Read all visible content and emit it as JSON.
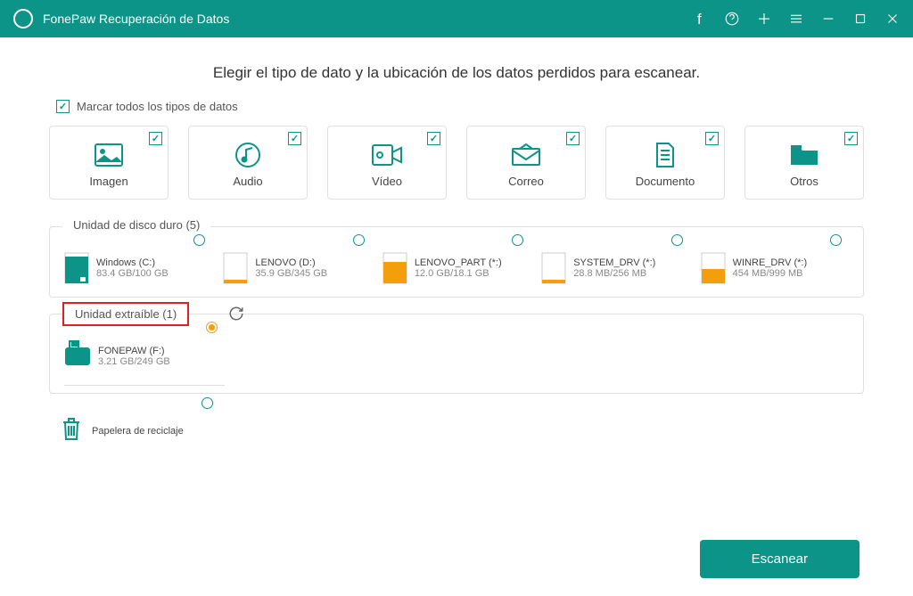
{
  "app": {
    "title": "FonePaw Recuperación de Datos"
  },
  "heading": "Elegir el tipo de dato y la ubicación de los datos perdidos para escanear.",
  "masterCheck": "Marcar todos los tipos de datos",
  "types": [
    {
      "label": "Imagen"
    },
    {
      "label": "Audio"
    },
    {
      "label": "Vídeo"
    },
    {
      "label": "Correo"
    },
    {
      "label": "Documento"
    },
    {
      "label": "Otros"
    }
  ],
  "hdd": {
    "title": "Unidad de disco duro (5)",
    "drives": [
      {
        "name": "Windows (C:)",
        "size": "83.4 GB/100 GB",
        "fill": 0.83,
        "color": "#0d9488"
      },
      {
        "name": "LENOVO (D:)",
        "size": "35.9 GB/345 GB",
        "fill": 0.1,
        "color": "#f59e0b"
      },
      {
        "name": "LENOVO_PART (*:)",
        "size": "12.0 GB/18.1 GB",
        "fill": 0.66,
        "color": "#f59e0b"
      },
      {
        "name": "SYSTEM_DRV (*:)",
        "size": "28.8 MB/256 MB",
        "fill": 0.11,
        "color": "#f59e0b"
      },
      {
        "name": "WINRE_DRV (*:)",
        "size": "454 MB/999 MB",
        "fill": 0.45,
        "color": "#f59e0b"
      }
    ]
  },
  "removable": {
    "title": "Unidad extraíble (1)",
    "drives": [
      {
        "name": "FONEPAW (F:)",
        "size": "3.21 GB/249 GB"
      }
    ]
  },
  "recycle": {
    "label": "Papelera de reciclaje"
  },
  "scanBtn": "Escanear"
}
